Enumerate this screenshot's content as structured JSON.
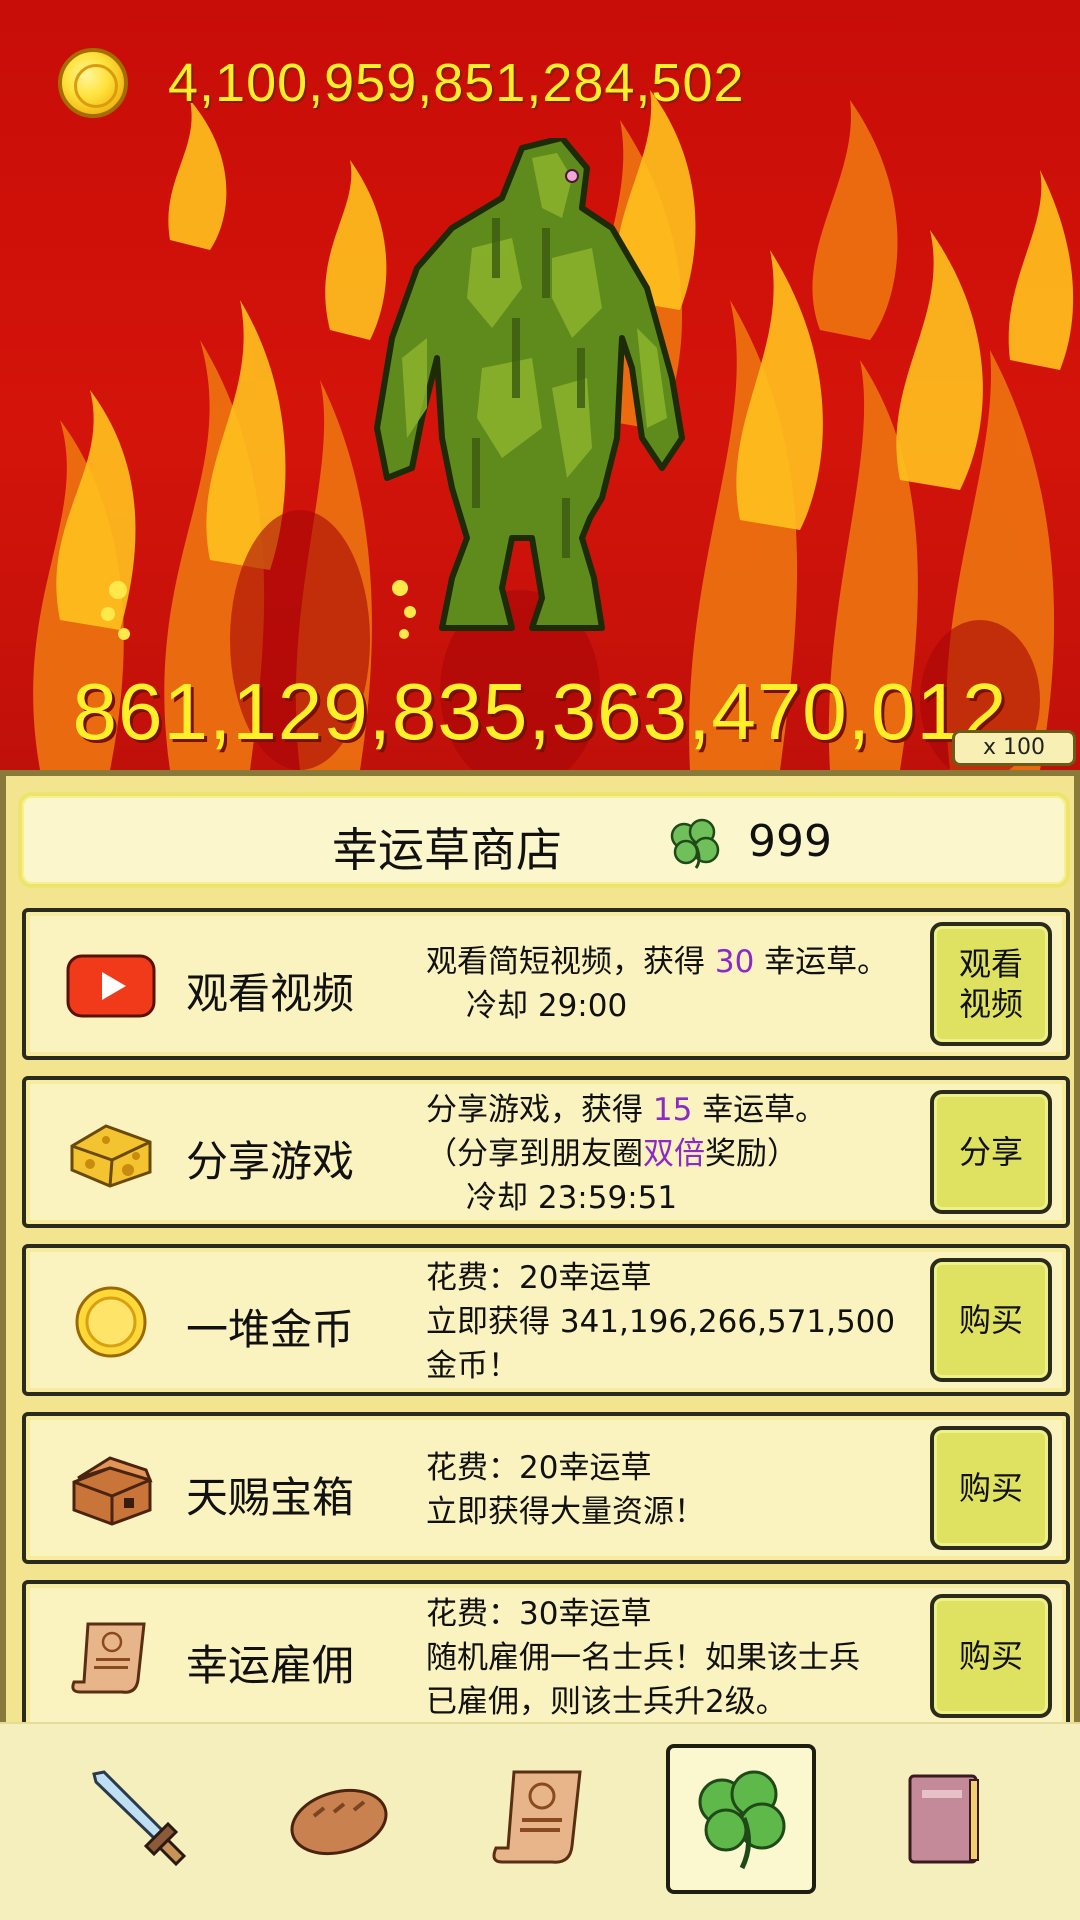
{
  "battle": {
    "gold": "4,100,959,851,284,502",
    "monster_hp": "861,129,835,363,470,012",
    "multiplier": "x 100"
  },
  "shop": {
    "title": "幸运草商店",
    "clover_count": "999",
    "items": [
      {
        "name": "观看视频",
        "desc_line1_pre": "观看简短视频，获得 ",
        "desc_line1_hl": "30",
        "desc_line1_post": " 幸运草。",
        "desc_line2": "冷却 29:00",
        "button": [
          "观看",
          "视频"
        ],
        "icon": "video-play-icon"
      },
      {
        "name": "分享游戏",
        "desc_line1_pre": "分享游戏，获得 ",
        "desc_line1_hl": "15",
        "desc_line1_post": " 幸运草。",
        "desc_line2_pre": "（分享到朋友圈",
        "desc_line2_hl": "双倍",
        "desc_line2_post": "奖励）",
        "desc_line3": "冷却 23:59:51",
        "button": [
          "分享"
        ],
        "icon": "cheese-icon"
      },
      {
        "name": "一堆金币",
        "desc_line1": "花费：20幸运草",
        "desc_line2": "立即获得 341,196,266,571,500",
        "desc_line3": "金币！",
        "button": [
          "购买"
        ],
        "icon": "gold-coin-icon"
      },
      {
        "name": "天赐宝箱",
        "desc_line1": "花费：20幸运草",
        "desc_line2": "立即获得大量资源！",
        "button": [
          "购买"
        ],
        "icon": "treasure-chest-icon"
      },
      {
        "name": "幸运雇佣",
        "desc_line1": "花费：30幸运草",
        "desc_line2": "随机雇佣一名士兵！如果该士兵",
        "desc_line3": "已雇佣，则该士兵升2级。",
        "button": [
          "购买"
        ],
        "icon": "scroll-icon"
      }
    ]
  },
  "nav": {
    "items": [
      "sword-icon",
      "bread-icon",
      "scroll-icon",
      "clover-icon",
      "book-icon"
    ],
    "active": 3
  },
  "colors": {
    "background_red": "#c80c08",
    "gold_text": "#ffef2a",
    "panel": "#f3e590",
    "button": "#dfe260",
    "highlight": "#8b2bc4"
  }
}
